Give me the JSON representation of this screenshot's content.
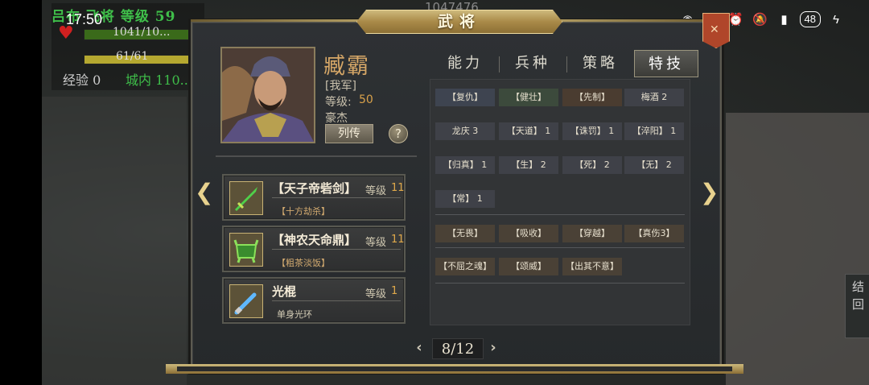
{
  "status_bar": {
    "time": "17:50",
    "battery": "48",
    "icons": [
      "eye-icon",
      "nfc-icon",
      "alarm-icon",
      "mute-icon",
      "signal-icon",
      "battery-icon",
      "charging-icon"
    ]
  },
  "hud": {
    "hero_name": "吕布  飞将  等级  59",
    "hp": "1041/10...",
    "mp": "61/61",
    "mp_fill": 0.95,
    "exp_label": "经验  0",
    "city_label": "城内  110...",
    "map_top_value": "1047476"
  },
  "dialog": {
    "title": "武将"
  },
  "general": {
    "name": "臧霸",
    "faction": "[我军]",
    "level_label": "等级:",
    "level_value": "50",
    "trait": "豪杰",
    "bio_button": "列传",
    "help_button": "?"
  },
  "equipment": [
    {
      "name": "【天子帝砦剑】",
      "level_label": "等级",
      "level": "11",
      "sub": "【十方劫杀】",
      "icon": "sword-icon"
    },
    {
      "name": "【神农天命鼎】",
      "level_label": "等级",
      "level": "11",
      "sub": "【粗茶淡饭】",
      "icon": "cauldron-icon"
    },
    {
      "name": "光棍",
      "level_label": "等级",
      "level": "1",
      "sub": "单身光环",
      "icon": "lightsaber-icon"
    }
  ],
  "tabs": [
    {
      "label": "能力",
      "active": false
    },
    {
      "label": "兵种",
      "active": false
    },
    {
      "label": "策略",
      "active": false
    },
    {
      "label": "特技",
      "active": true
    }
  ],
  "skills": {
    "row1": [
      {
        "label": "【复仇】",
        "style": "blue"
      },
      {
        "label": "【健壮】",
        "style": "green"
      },
      {
        "label": "【先制】",
        "style": "brown"
      },
      {
        "label": "梅酒 2",
        "style": "plain"
      }
    ],
    "row2": [
      {
        "label": "龙庆 3",
        "style": "plain"
      },
      {
        "label": "【天道】 1",
        "style": "plain"
      },
      {
        "label": "【诛罚】 1",
        "style": "plain"
      },
      {
        "label": "【淬阳】 1",
        "style": "plain"
      }
    ],
    "row3": [
      {
        "label": "【归真】 1",
        "style": "plain"
      },
      {
        "label": "【生】 2",
        "style": "plain"
      },
      {
        "label": "【死】 2",
        "style": "plain"
      },
      {
        "label": "【无】 2",
        "style": "plain"
      }
    ],
    "row4": [
      {
        "label": "【常】 1",
        "style": "plain"
      }
    ],
    "row5": [
      {
        "label": "【无畏】",
        "style": "tan"
      },
      {
        "label": "【吸收】",
        "style": "tan"
      },
      {
        "label": "【穿越】",
        "style": "tan"
      },
      {
        "label": "【真伤3】",
        "style": "tan"
      }
    ],
    "row6": [
      {
        "label": "【不屈之魂】",
        "style": "tan"
      },
      {
        "label": "【颂威】",
        "style": "tan"
      },
      {
        "label": "【出其不意】",
        "style": "tan"
      }
    ]
  },
  "pagination": {
    "current": "8/12",
    "prev": "‹",
    "next": "›"
  },
  "right_side_text": [
    "结",
    "回"
  ]
}
